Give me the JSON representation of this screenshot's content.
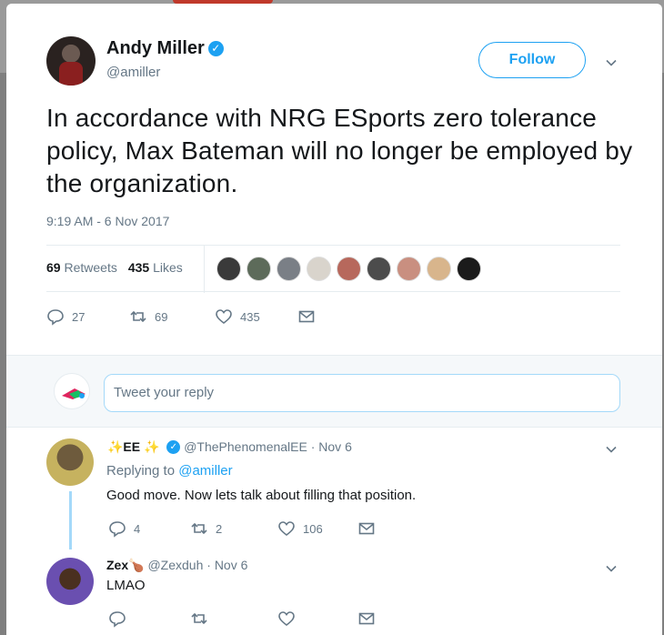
{
  "tweet": {
    "author_name": "Andy Miller",
    "author_handle": "@amiller",
    "follow_label": "Follow",
    "text": "In accordance with NRG ESports zero tolerance policy, Max Bateman will no longer be employed by the organization.",
    "timestamp": "9:19 AM - 6 Nov 2017",
    "retweets_count": "69",
    "retweets_label": "Retweets",
    "likes_count": "435",
    "likes_label": "Likes",
    "actions": {
      "replies": "27",
      "retweets": "69",
      "likes": "435"
    }
  },
  "reply_box": {
    "placeholder": "Tweet your reply"
  },
  "replies": [
    {
      "name": "✨EE ✨",
      "handle": "@ThePhenomenalEE",
      "date": "· Nov 6",
      "replying_prefix": "Replying to",
      "replying_to": "@amiller",
      "text": "Good move. Now lets talk about filling that position.",
      "actions": {
        "replies": "4",
        "retweets": "2",
        "likes": "106"
      }
    },
    {
      "name": "Zex",
      "name_emoji": "🍗",
      "handle": "@Zexduh",
      "date": "· Nov 6",
      "text": "LMAO",
      "actions": {
        "replies": "",
        "retweets": "",
        "likes": ""
      }
    }
  ],
  "colors": {
    "accent": "#1da1f2",
    "muted": "#657786",
    "text": "#14171a"
  },
  "icons": [
    "verified-badge-icon",
    "chevron-down-icon",
    "reply-icon",
    "retweet-icon",
    "heart-icon",
    "envelope-icon"
  ]
}
